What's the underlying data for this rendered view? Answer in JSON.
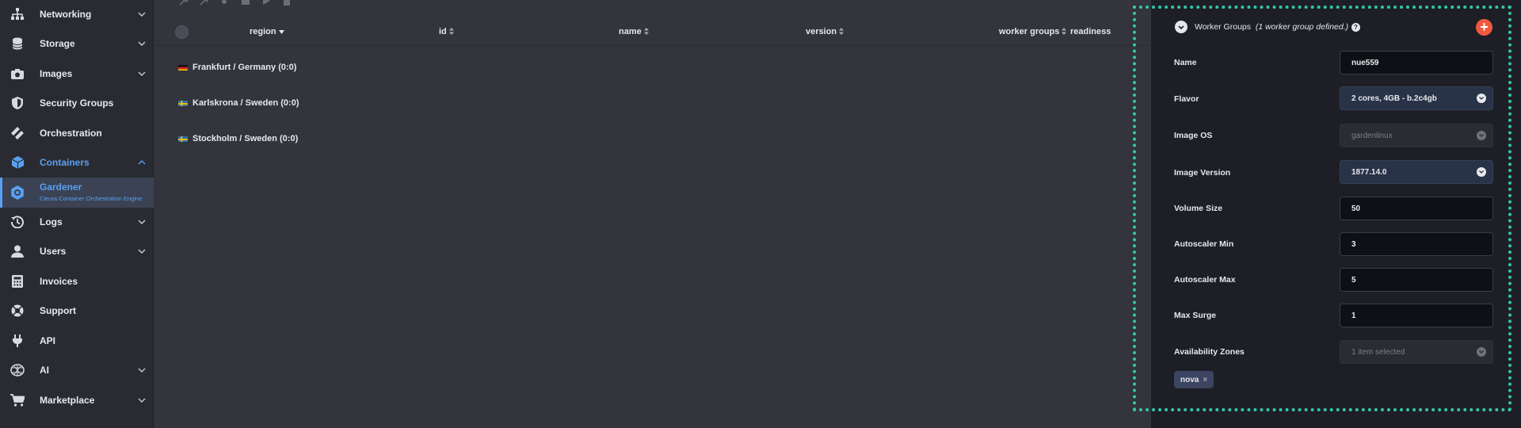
{
  "sidebar": {
    "items": [
      {
        "label": "Networking",
        "icon": "network-icon",
        "chevron": "down"
      },
      {
        "label": "Storage",
        "icon": "database-icon",
        "chevron": "down"
      },
      {
        "label": "Images",
        "icon": "camera-icon",
        "chevron": "down"
      },
      {
        "label": "Security Groups",
        "icon": "shield-icon",
        "chevron": ""
      },
      {
        "label": "Orchestration",
        "icon": "layers-icon",
        "chevron": ""
      },
      {
        "label": "Containers",
        "icon": "cube-icon",
        "chevron": "up"
      },
      {
        "label": "Gardener",
        "sublabel": "Cleura Container Orchestration Engine",
        "icon": "gardener-icon",
        "chevron": ""
      },
      {
        "label": "Logs",
        "icon": "history-icon",
        "chevron": "down"
      },
      {
        "label": "Users",
        "icon": "user-icon",
        "chevron": "down"
      },
      {
        "label": "Invoices",
        "icon": "invoice-icon",
        "chevron": ""
      },
      {
        "label": "Support",
        "icon": "lifebuoy-icon",
        "chevron": ""
      },
      {
        "label": "API",
        "icon": "plug-icon",
        "chevron": ""
      },
      {
        "label": "AI",
        "icon": "ai-icon",
        "chevron": "down"
      },
      {
        "label": "Marketplace",
        "icon": "cart-icon",
        "chevron": "down"
      }
    ]
  },
  "table": {
    "columns": {
      "region": "region",
      "id": "id",
      "name": "name",
      "version": "version",
      "worker_groups": "worker groups",
      "readiness": "readiness"
    },
    "rows": [
      {
        "label": "Frankfurt / Germany (0:0)",
        "flag": "germany-flag-icon"
      },
      {
        "label": "Karlskrona / Sweden (0:0)",
        "flag": "sweden-flag-icon"
      },
      {
        "label": "Stockholm / Sweden (0:0)",
        "flag": "sweden-flag-icon"
      }
    ]
  },
  "panel": {
    "title": "Worker Groups",
    "subtitle": "(1 worker group defined.)",
    "help": "?",
    "add": "+",
    "fields": {
      "name": {
        "label": "Name",
        "value": "nue559"
      },
      "flavor": {
        "label": "Flavor",
        "value": "2 cores, 4GB - b.2c4gb"
      },
      "image_os": {
        "label": "Image OS",
        "value": "gardenlinux"
      },
      "image_version": {
        "label": "Image Version",
        "value": "1877.14.0"
      },
      "volume_size": {
        "label": "Volume Size",
        "value": "50"
      },
      "autoscaler_min": {
        "label": "Autoscaler Min",
        "value": "3"
      },
      "autoscaler_max": {
        "label": "Autoscaler Max",
        "value": "5"
      },
      "max_surge": {
        "label": "Max Surge",
        "value": "1"
      },
      "zones": {
        "label": "Availability Zones",
        "value": "1 item selected"
      }
    },
    "zone_tag": "nova",
    "zone_tag_remove": "×"
  },
  "colors": {
    "accent": "#5aa0f2",
    "add_button": "#ef5a3f",
    "highlight_frame": "#32c8a8"
  }
}
